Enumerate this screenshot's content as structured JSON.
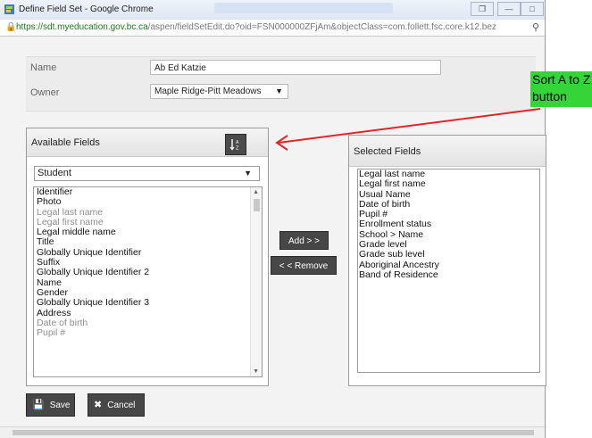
{
  "window": {
    "title": "Define Field Set - Google Chrome",
    "url_host": "https://sdt.myeducation.gov.bc.ca",
    "url_rest": "/aspen/fieldSetEdit.do?oid=FSN000000ZFjAm&objectClass=com.follett.fsc.core.k12.bez",
    "controls": [
      "❐",
      "—",
      "□",
      "✕"
    ]
  },
  "form": {
    "name_label": "Name",
    "name_value": "Ab Ed Katzie",
    "owner_label": "Owner",
    "owner_value": "Maple Ridge-Pitt Meadows"
  },
  "available": {
    "header": "Available Fields",
    "sort_icon": "sort-a-to-z-icon",
    "sort_glyph": "↓ᴀ",
    "table_select": "Student",
    "items": [
      {
        "label": "Identifier",
        "dim": false
      },
      {
        "label": "Photo",
        "dim": false
      },
      {
        "label": "Legal last name",
        "dim": true
      },
      {
        "label": "Legal first name",
        "dim": true
      },
      {
        "label": "Legal middle name",
        "dim": false
      },
      {
        "label": "Title",
        "dim": false
      },
      {
        "label": "Globally Unique Identifier",
        "dim": false
      },
      {
        "label": "Suffix",
        "dim": false
      },
      {
        "label": "Globally Unique Identifier 2",
        "dim": false
      },
      {
        "label": "Name",
        "dim": false
      },
      {
        "label": "Gender",
        "dim": false
      },
      {
        "label": "Globally Unique Identifier 3",
        "dim": false
      },
      {
        "label": "Address",
        "dim": false
      },
      {
        "label": "Date of birth",
        "dim": true
      },
      {
        "label": "Pupil #",
        "dim": true
      }
    ]
  },
  "buttons": {
    "add": "Add > >",
    "remove": "< < Remove",
    "save": "Save",
    "cancel": "Cancel"
  },
  "selected": {
    "header": "Selected Fields",
    "items": [
      "Legal last name",
      "Legal first name",
      "Usual Name",
      "Date of birth",
      "Pupil #",
      "Enrollment status",
      "School > Name",
      "Grade level",
      "Grade sub level",
      "Aboriginal Ancestry",
      "Band of Residence"
    ]
  },
  "annotation": {
    "line1": "Sort A to Z",
    "line2": "button",
    "color": "#35d438",
    "arrow_color": "#e0262a"
  }
}
